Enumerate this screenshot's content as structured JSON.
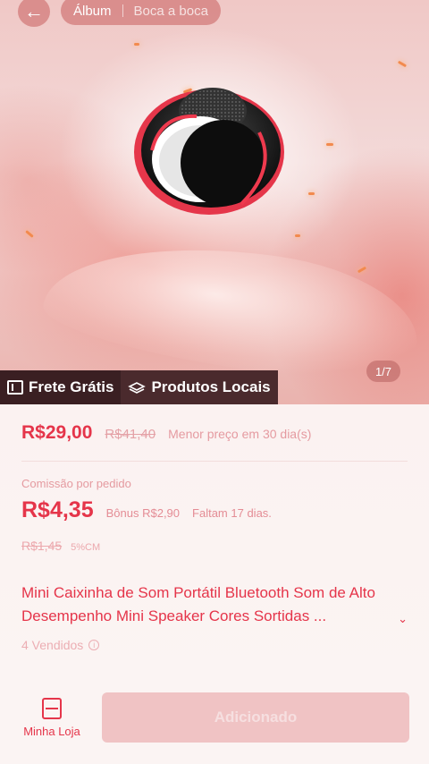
{
  "header": {
    "back_icon": "back-arrow-icon",
    "tabs": [
      {
        "label": "Álbum",
        "active": true
      },
      {
        "label": "Boca a boca",
        "active": false
      }
    ]
  },
  "gallery": {
    "counter": "1/7",
    "badges": [
      {
        "icon": "calendar-icon",
        "label": "Frete Grátis"
      },
      {
        "icon": "shipping-icon",
        "label": "Produtos Locais"
      }
    ]
  },
  "pricing": {
    "price": "R$29,00",
    "original_price": "R$41,40",
    "lowest_note": "Menor preço em 30 dia(s)"
  },
  "commission": {
    "label": "Comissão por pedido",
    "value": "R$4,35",
    "bonus": "Bônus R$2,90",
    "time_left": "Faltam 17 dias.",
    "old_value": "R$1,45",
    "rate": "5%CM"
  },
  "product": {
    "title": "Mini Caixinha de Som Portátil Bluetooth Som de Alto Desempenho Mini Speaker Cores Sortidas ...",
    "sold": "4 Vendidos"
  },
  "bottom_bar": {
    "store_label": "Minha Loja",
    "add_button_label": "Adicionado"
  },
  "colors": {
    "accent": "#e5354a",
    "badge_bg": "#3a1f22"
  }
}
